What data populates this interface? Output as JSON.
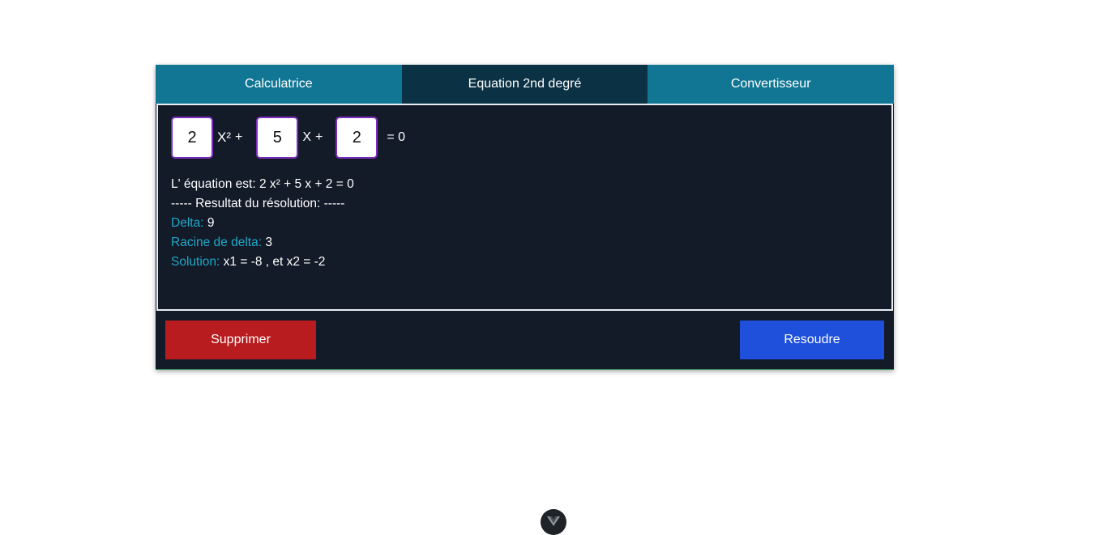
{
  "tabs": [
    {
      "label": "Calculatrice",
      "active": false
    },
    {
      "label": "Equation 2nd degré",
      "active": true
    },
    {
      "label": "Convertisseur",
      "active": false
    }
  ],
  "equation": {
    "a": "2",
    "b": "5",
    "c": "2",
    "term_x2": "X²",
    "plus1": "+",
    "term_x": "X",
    "plus2": "+",
    "equals": "= 0"
  },
  "results": {
    "equation_line": "L' équation est: 2 x² + 5 x + 2 = 0",
    "header_line": "----- Resultat du résolution: -----",
    "delta_label": "Delta:",
    "delta_value": "9",
    "root_label": "Racine de delta:",
    "root_value": "3",
    "solution_label": "Solution:",
    "solution_value": "x1 = -8 , et x2 = -2"
  },
  "buttons": {
    "delete_label": "Supprimer",
    "solve_label": "Resoudre"
  },
  "colors": {
    "tab_bg": "#117694",
    "tab_active_bg": "#0b3244",
    "panel_bg": "#131a28",
    "label_accent": "#1fa8c9",
    "delete_button": "#b81c1e",
    "solve_button": "#1e50dc",
    "input_border": "#7c2dbf"
  },
  "devtools_badge": {
    "icon": "vue-logo-icon"
  }
}
